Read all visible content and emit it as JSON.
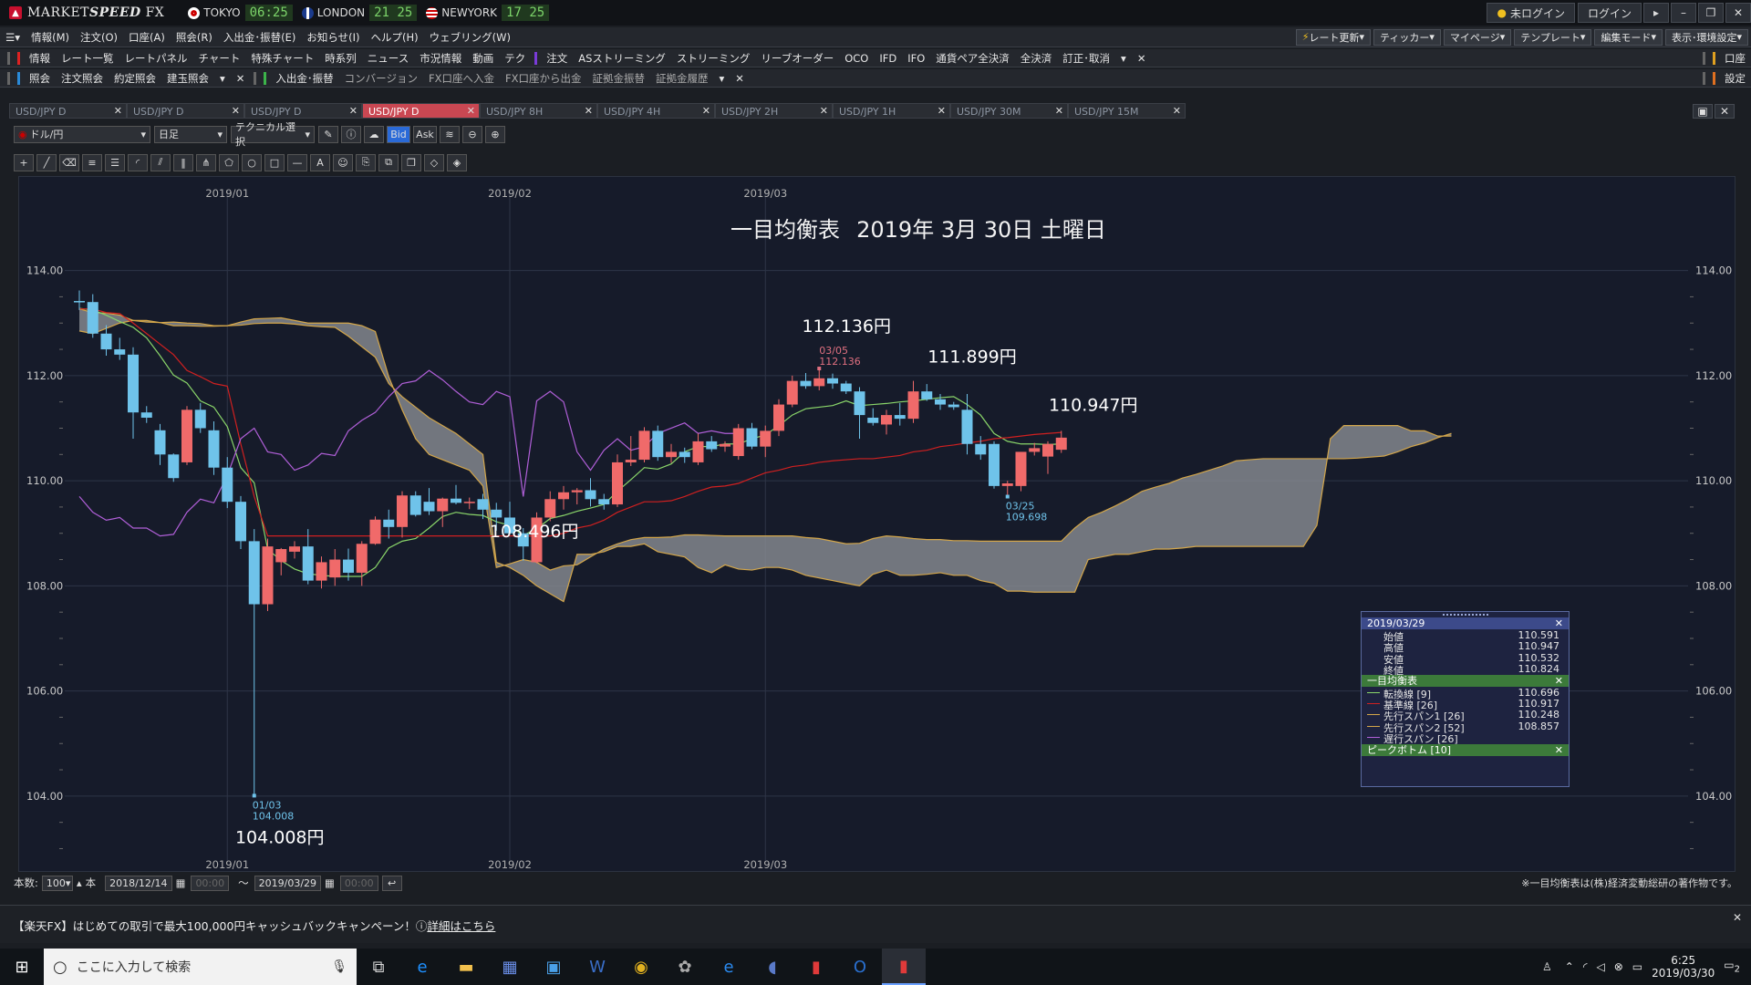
{
  "title_bar": {
    "app_name_1": "MARKET",
    "app_name_2": "SPEED",
    "app_name_3": " FX",
    "clocks": [
      {
        "label": "TOKYO",
        "time": "06:25"
      },
      {
        "label": "LONDON",
        "time": "21 25"
      },
      {
        "label": "NEWYORK",
        "time": "17 25"
      }
    ],
    "login_status": "未ログイン",
    "login_button": "ログイン"
  },
  "menu": [
    "情報(M)",
    "注文(O)",
    "口座(A)",
    "照会(R)",
    "入出金･振替(E)",
    "お知らせ(I)",
    "ヘルプ(H)",
    "ウェブリング(W)"
  ],
  "menu_right": [
    "レート更新",
    "ティッカー",
    "マイページ",
    "テンプレート",
    "編集モード",
    "表示･環境設定"
  ],
  "toolbar1": {
    "section_label": "情報",
    "items": [
      "レート一覧",
      "レートパネル",
      "チャート",
      "特殊チャート",
      "時系列",
      "ニュース",
      "市況情報",
      "動画",
      "テク"
    ],
    "order_label": "注文",
    "order_items": [
      "ASストリーミング",
      "ストリーミング",
      "リーブオーダー",
      "OCO",
      "IFD",
      "IFO",
      "通貨ペア全決済",
      "全決済",
      "訂正･取消"
    ],
    "right_label": "口座"
  },
  "toolbar2": {
    "section_label": "照会",
    "items": [
      "注文照会",
      "約定照会",
      "建玉照会"
    ],
    "deposit_label": "入出金･振替",
    "deposit_items": [
      "コンバージョン",
      "FX口座へ入金",
      "FX口座から出金",
      "証拠金振替",
      "証拠金履歴"
    ],
    "right_label": "設定"
  },
  "tabs": [
    "USD/JPY D",
    "USD/JPY D",
    "USD/JPY D",
    "USD/JPY D",
    "USD/JPY 8H",
    "USD/JPY 4H",
    "USD/JPY 2H",
    "USD/JPY 1H",
    "USD/JPY 30M",
    "USD/JPY 15M"
  ],
  "chart_toolbar": {
    "pair": "ドル/円",
    "period": "日足",
    "technical": "テクニカル選択",
    "bid": "Bid",
    "ask": "Ask"
  },
  "chart_data": {
    "type": "candlestick",
    "title": "一目均衡表",
    "date_label": "2019年 3月 30日 土曜日",
    "y_ticks": [
      "114.00",
      "112.00",
      "110.00",
      "108.00",
      "106.00",
      "104.00"
    ],
    "ylim": [
      102.8,
      115.0
    ],
    "x_ticks": [
      "2019/01",
      "2019/02",
      "2019/03"
    ],
    "x_tick_index": [
      11,
      32,
      51
    ],
    "grid": true,
    "candles": [
      [
        113.42,
        113.62,
        113.25,
        113.4
      ],
      [
        113.4,
        113.55,
        112.72,
        112.8
      ],
      [
        112.8,
        112.96,
        112.38,
        112.5
      ],
      [
        112.5,
        112.72,
        112.3,
        112.4
      ],
      [
        112.4,
        112.54,
        110.8,
        111.3
      ],
      [
        111.3,
        111.42,
        111.1,
        111.2
      ],
      [
        110.96,
        111.08,
        110.3,
        110.5
      ],
      [
        110.5,
        110.52,
        109.98,
        110.05
      ],
      [
        110.35,
        111.42,
        110.3,
        111.35
      ],
      [
        111.35,
        111.48,
        110.91,
        111.0
      ],
      [
        110.96,
        111.13,
        110.11,
        110.25
      ],
      [
        110.25,
        110.45,
        109.48,
        109.6
      ],
      [
        109.6,
        109.71,
        108.7,
        108.85
      ],
      [
        108.85,
        109.08,
        104.01,
        107.65
      ],
      [
        107.65,
        108.9,
        107.52,
        108.75
      ],
      [
        108.45,
        108.72,
        108.2,
        108.7
      ],
      [
        108.65,
        108.85,
        108.52,
        108.75
      ],
      [
        108.75,
        109.08,
        108.03,
        108.1
      ],
      [
        108.1,
        108.56,
        107.95,
        108.45
      ],
      [
        108.16,
        108.7,
        108.0,
        108.5
      ],
      [
        108.5,
        108.71,
        108.1,
        108.25
      ],
      [
        108.25,
        108.85,
        108.0,
        108.8
      ],
      [
        108.8,
        109.32,
        108.78,
        109.26
      ],
      [
        109.26,
        109.45,
        108.9,
        109.12
      ],
      [
        109.12,
        109.8,
        108.92,
        109.72
      ],
      [
        109.72,
        109.8,
        109.32,
        109.35
      ],
      [
        109.6,
        109.86,
        109.35,
        109.42
      ],
      [
        109.42,
        109.68,
        109.12,
        109.66
      ],
      [
        109.66,
        109.92,
        109.55,
        109.58
      ],
      [
        109.58,
        109.68,
        109.46,
        109.6
      ],
      [
        109.65,
        109.75,
        109.27,
        109.45
      ],
      [
        109.45,
        109.58,
        109.05,
        109.3
      ],
      [
        109.3,
        109.6,
        108.98,
        109.0
      ],
      [
        109.0,
        109.1,
        108.48,
        108.75
      ],
      [
        108.45,
        109.4,
        108.43,
        109.3
      ],
      [
        109.3,
        109.8,
        109.23,
        109.65
      ],
      [
        109.65,
        109.9,
        109.45,
        109.78
      ],
      [
        109.78,
        109.86,
        109.55,
        109.82
      ],
      [
        109.82,
        110.05,
        109.51,
        109.65
      ],
      [
        109.65,
        109.75,
        109.45,
        109.55
      ],
      [
        109.55,
        110.5,
        109.5,
        110.35
      ],
      [
        110.35,
        110.85,
        110.28,
        110.4
      ],
      [
        110.4,
        111.02,
        110.35,
        110.95
      ],
      [
        110.95,
        111.05,
        110.38,
        110.45
      ],
      [
        110.45,
        110.7,
        110.34,
        110.55
      ],
      [
        110.55,
        110.63,
        110.34,
        110.45
      ],
      [
        110.35,
        110.9,
        110.3,
        110.75
      ],
      [
        110.75,
        110.85,
        110.55,
        110.6
      ],
      [
        110.65,
        110.75,
        110.55,
        110.7
      ],
      [
        110.47,
        111.08,
        110.4,
        111.0
      ],
      [
        111.0,
        111.1,
        110.6,
        110.65
      ],
      [
        110.65,
        111.05,
        110.45,
        110.95
      ],
      [
        110.95,
        111.55,
        110.85,
        111.45
      ],
      [
        111.45,
        112.0,
        111.4,
        111.9
      ],
      [
        111.9,
        112.05,
        111.75,
        111.8
      ],
      [
        111.8,
        112.14,
        111.72,
        111.95
      ],
      [
        111.95,
        112.04,
        111.75,
        111.85
      ],
      [
        111.85,
        111.9,
        111.65,
        111.7
      ],
      [
        111.7,
        111.78,
        110.8,
        111.25
      ],
      [
        111.2,
        111.38,
        111.05,
        111.1
      ],
      [
        111.07,
        111.35,
        110.88,
        111.25
      ],
      [
        111.25,
        111.48,
        111.05,
        111.18
      ],
      [
        111.18,
        111.9,
        111.1,
        111.7
      ],
      [
        111.7,
        111.84,
        111.52,
        111.55
      ],
      [
        111.55,
        111.65,
        111.35,
        111.45
      ],
      [
        111.45,
        111.5,
        111.35,
        111.4
      ],
      [
        111.35,
        111.65,
        110.5,
        110.7
      ],
      [
        110.7,
        110.85,
        110.4,
        110.5
      ],
      [
        110.7,
        110.75,
        109.85,
        109.9
      ],
      [
        109.9,
        110.0,
        109.7,
        109.95
      ],
      [
        109.9,
        110.5,
        109.8,
        110.55
      ],
      [
        110.55,
        110.72,
        110.48,
        110.62
      ],
      [
        110.46,
        110.75,
        110.13,
        110.7
      ],
      [
        110.59,
        110.95,
        110.53,
        110.82
      ]
    ],
    "tenkan": [
      113.28,
      113.25,
      113.15,
      113.03,
      112.92,
      112.72,
      112.38,
      112.01,
      111.86,
      111.52,
      111.4,
      111.03,
      110.25,
      109.96,
      108.7,
      108.48,
      108.32,
      108.23,
      108.2,
      108.18,
      108.18,
      108.18,
      108.35,
      108.72,
      108.85,
      108.9,
      109.1,
      109.32,
      109.4,
      109.36,
      109.34,
      109.22,
      109.15,
      108.96,
      109.09,
      109.28,
      109.34,
      109.42,
      109.48,
      109.55,
      109.8,
      110.02,
      110.25,
      110.22,
      110.32,
      110.55,
      110.65,
      110.65,
      110.7,
      110.7,
      110.8,
      110.87,
      111.05,
      111.25,
      111.37,
      111.4,
      111.43,
      111.52,
      111.43,
      111.45,
      111.47,
      111.5,
      111.52,
      111.55,
      111.58,
      111.6,
      111.45,
      111.25,
      110.9,
      110.75,
      110.7,
      110.7,
      110.69,
      110.7
    ],
    "kijun": [
      113.27,
      113.27,
      113.2,
      113.18,
      113.0,
      112.8,
      112.6,
      112.4,
      112.1,
      111.98,
      111.85,
      111.8,
      110.7,
      109.7,
      108.95,
      108.95,
      108.95,
      108.95,
      108.95,
      108.95,
      108.95,
      108.95,
      108.95,
      108.95,
      108.95,
      108.95,
      108.95,
      108.95,
      108.95,
      108.95,
      108.95,
      108.95,
      108.95,
      108.95,
      108.95,
      108.95,
      109.0,
      109.1,
      109.15,
      109.25,
      109.4,
      109.5,
      109.6,
      109.6,
      109.62,
      109.7,
      109.8,
      109.88,
      109.9,
      109.95,
      110.05,
      110.15,
      110.2,
      110.27,
      110.3,
      110.35,
      110.38,
      110.4,
      110.42,
      110.42,
      110.45,
      110.48,
      110.55,
      110.58,
      110.65,
      110.68,
      110.72,
      110.75,
      110.8,
      110.82,
      110.85,
      110.88,
      110.9,
      110.92
    ],
    "chikou": [
      109.7,
      109.4,
      109.25,
      109.3,
      109.1,
      109.1,
      108.95,
      108.98,
      109.4,
      109.65,
      109.58,
      110.1,
      110.8,
      111.0,
      110.55,
      110.5,
      110.2,
      110.3,
      110.52,
      110.48,
      110.95,
      111.15,
      111.3,
      111.6,
      111.85,
      111.9,
      112.1,
      111.92,
      111.7,
      111.5,
      111.45,
      111.7,
      111.6,
      109.7,
      111.52,
      111.7,
      111.5,
      110.55,
      110.2,
      110.58,
      110.8,
      110.58,
      110.65,
      110.9,
      111.0,
      111.1,
      110.9,
      110.95,
      110.9,
      110.9
    ],
    "span1": [
      113.27,
      113.2,
      113.19,
      113.15,
      113.05,
      113.05,
      113.01,
      112.95,
      112.95,
      112.94,
      112.94,
      112.95,
      113.02,
      113.08,
      113.09,
      113.1,
      113.05,
      113.0,
      113.0,
      113.0,
      113.0,
      112.95,
      112.84,
      111.98,
      111.35,
      110.8,
      110.5,
      110.4,
      110.3,
      110.2,
      109.9,
      108.35,
      108.42,
      108.5,
      108.45,
      108.3,
      108.38,
      108.4,
      108.55,
      108.7,
      108.8,
      108.88,
      108.92,
      108.92,
      108.93,
      108.97,
      108.97,
      108.96,
      108.95,
      108.95,
      108.95,
      108.95,
      108.95,
      108.95,
      108.92,
      108.9,
      108.85,
      108.8,
      108.81,
      108.9,
      108.95,
      108.93,
      108.9,
      108.88,
      108.88,
      108.86,
      108.86,
      108.85,
      108.85,
      108.85,
      108.85,
      108.85,
      108.85,
      108.85,
      109.1,
      109.3,
      109.4,
      109.52,
      109.65,
      109.8,
      109.88,
      109.95,
      110.05,
      110.12,
      110.2,
      110.28,
      110.38,
      110.4,
      110.42,
      110.42,
      110.42,
      110.42,
      110.42,
      110.42,
      110.42,
      110.43,
      110.45,
      110.47,
      110.55,
      110.65,
      110.72,
      110.82,
      110.9
    ],
    "span2": [
      112.85,
      112.8,
      112.9,
      113.0,
      113.05,
      113.02,
      113.01,
      113.02,
      113.0,
      112.99,
      112.95,
      112.95,
      112.96,
      112.99,
      113.0,
      113.0,
      112.98,
      112.95,
      112.93,
      112.92,
      112.75,
      112.55,
      112.35,
      111.85,
      111.6,
      111.4,
      111.2,
      111.05,
      110.9,
      110.7,
      110.5,
      108.45,
      108.35,
      108.2,
      108.0,
      107.85,
      107.7,
      108.6,
      108.6,
      108.65,
      108.75,
      108.75,
      108.8,
      108.65,
      108.6,
      108.55,
      108.35,
      108.25,
      108.4,
      108.32,
      108.3,
      108.35,
      108.35,
      108.3,
      108.2,
      108.15,
      108.1,
      108.05,
      108.0,
      108.22,
      108.3,
      108.2,
      108.2,
      108.22,
      108.25,
      108.2,
      108.2,
      108.1,
      108.05,
      107.9,
      107.9,
      107.88,
      107.88,
      107.88,
      107.88,
      108.5,
      108.55,
      108.6,
      108.6,
      108.65,
      108.7,
      108.7,
      108.72,
      108.75,
      108.75,
      108.75,
      108.75,
      108.75,
      108.75,
      108.75,
      108.75,
      108.75,
      109.15,
      110.8,
      111.05,
      111.05,
      111.05,
      111.05,
      111.05,
      110.95,
      110.95,
      110.85,
      110.85
    ],
    "annotations": [
      {
        "text": "112.136円",
        "date": "03/05",
        "value": "112.136"
      },
      {
        "text": "111.899円"
      },
      {
        "text": "110.947円"
      },
      {
        "text": "108.496円"
      },
      {
        "text": "104.008円",
        "date": "01/03",
        "value": "104.008"
      },
      {
        "text": "03/25",
        "value": "109.698"
      }
    ]
  },
  "info_panel": {
    "date": "2019/03/29",
    "ohlc": [
      {
        "k": "始値",
        "v": "110.591"
      },
      {
        "k": "高値",
        "v": "110.947"
      },
      {
        "k": "安値",
        "v": "110.532"
      },
      {
        "k": "終値",
        "v": "110.824"
      }
    ],
    "ichimoku_title": "一目均衡表",
    "ichimoku": [
      {
        "k": "転換線 [9]",
        "v": "110.696",
        "color": "#8ad66a"
      },
      {
        "k": "基準線 [26]",
        "v": "110.917",
        "color": "#d02020"
      },
      {
        "k": "先行スパン1 [26]",
        "v": "110.248",
        "color": "#d3a64a"
      },
      {
        "k": "先行スパン2 [52]",
        "v": "108.857",
        "color": "#d3a64a"
      },
      {
        "k": "遅行スパン [26]",
        "v": "",
        "color": "#b05fd8"
      }
    ],
    "peak_title": "ピークボトム [10]"
  },
  "bottom_bar": {
    "count_label": "本数:",
    "count": "100",
    "unit": "本",
    "from": "2018/12/14",
    "to": "2019/03/29",
    "time_placeholder": "00:00",
    "note": "※一目均衡表は(株)経済変動総研の著作物です。"
  },
  "banner": {
    "text": "【楽天FX】はじめての取引で最大100,000円キャッシュバックキャンペーン！",
    "link": "詳細はこちら"
  },
  "taskbar": {
    "search_placeholder": "ここに入力して検索",
    "time": "6:25",
    "date": "2019/03/30",
    "notif": "2"
  }
}
